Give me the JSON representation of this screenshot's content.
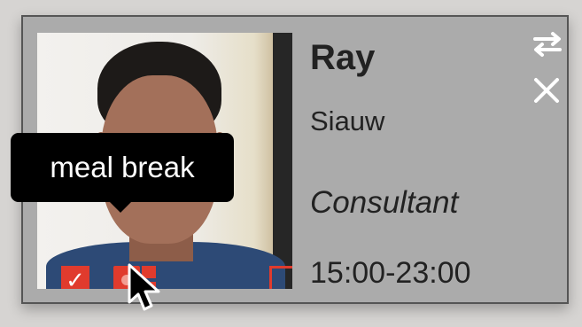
{
  "employee": {
    "first_name": "Ray",
    "last_name": "Siauw",
    "role": "Consultant",
    "shift": "15:00-23:00"
  },
  "tooltip": {
    "text": "meal break"
  },
  "icons": {
    "swap": "swap-arrows-icon",
    "close": "close-icon",
    "checked": "checkmark-icon",
    "meal": "meal-break-icon",
    "cursor": "mouse-pointer-icon"
  },
  "colors": {
    "card_bg": "#ababab",
    "accent_red": "#e03b2d",
    "tooltip_bg": "#000000"
  }
}
